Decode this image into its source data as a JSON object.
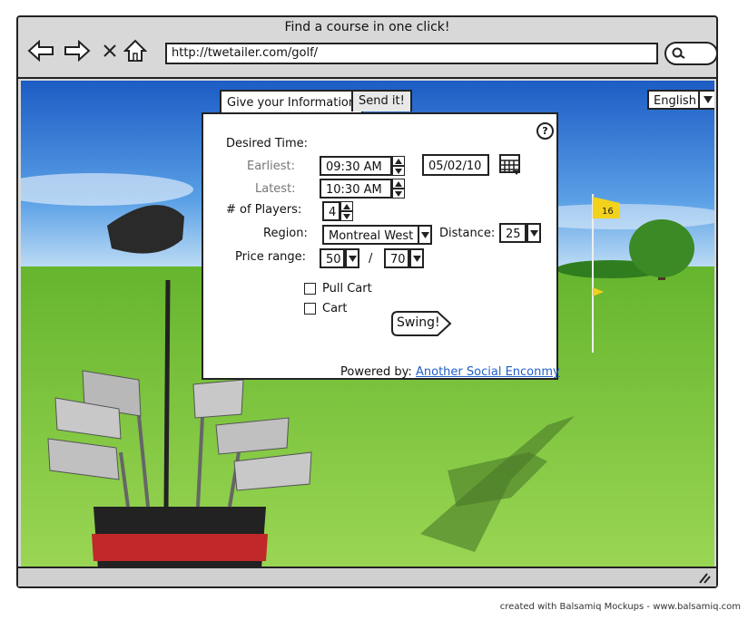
{
  "window": {
    "title": "Find a course in one click!",
    "url": "http://twetailer.com/golf/"
  },
  "language": {
    "selected": "English"
  },
  "tabs": [
    {
      "label": "Give your Information"
    },
    {
      "label": "Send it!"
    }
  ],
  "form": {
    "desired_time_label": "Desired Time:",
    "earliest_label": "Earliest:",
    "earliest_value": "09:30 AM",
    "date_value": "05/02/10",
    "latest_label": "Latest:",
    "latest_value": "10:30 AM",
    "players_label": "# of Players:",
    "players_value": "4",
    "region_label": "Region:",
    "region_value": "Montreal West",
    "distance_label": "Distance:",
    "distance_value": "25",
    "price_label": "Price range:",
    "price_min": "50",
    "price_sep": "/",
    "price_max": "70",
    "options": [
      {
        "label": "Pull Cart",
        "checked": false
      },
      {
        "label": "Cart",
        "checked": false
      }
    ],
    "swing_label": "Swing!",
    "help_glyph": "?",
    "powered_by": "Powered by:",
    "powered_link": "Another Social Enconmy"
  },
  "flag_number": "16",
  "footer_credit": "created with Balsamiq Mockups - www.balsamiq.com",
  "icons": [
    "back-arrow-icon",
    "forward-arrow-icon",
    "stop-icon",
    "home-icon",
    "search-icon",
    "calendar-icon",
    "help-icon",
    "chevron-down-icon",
    "resize-grip-icon"
  ],
  "colors": {
    "sky_top": "#1f64c8",
    "grass": "#7cc43a",
    "flag": "#f2d21a",
    "link": "#1f5fc9"
  }
}
